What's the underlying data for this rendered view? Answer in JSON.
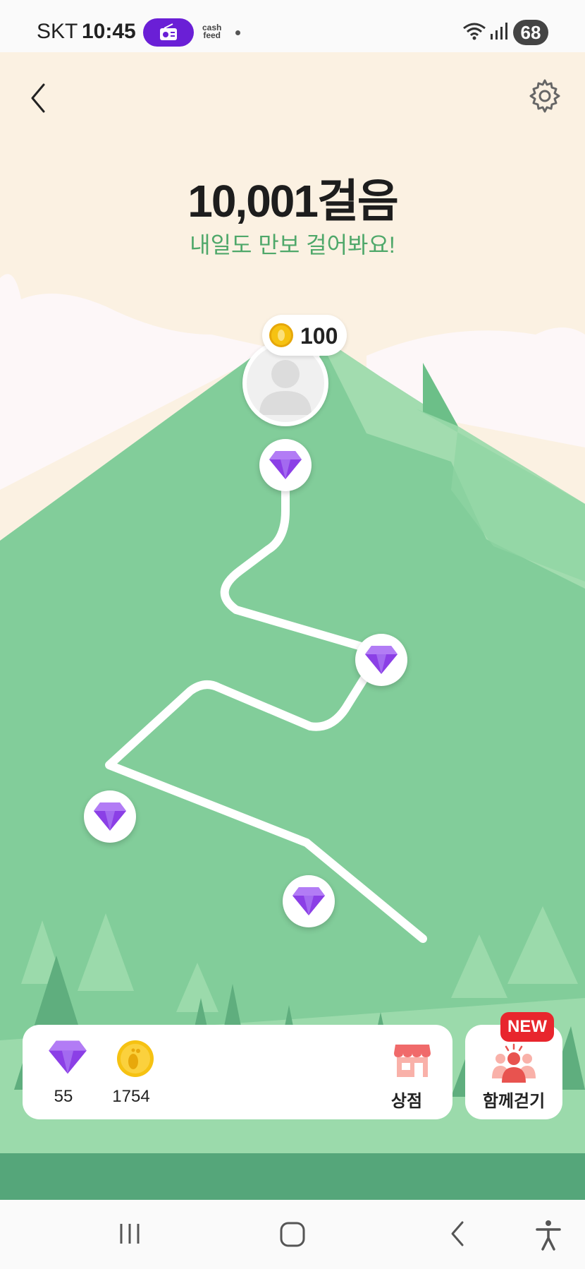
{
  "status_bar": {
    "carrier": "SKT",
    "time": "10:45",
    "notification_label": "cash feed",
    "battery": "68"
  },
  "header": {
    "back_icon": "chevron-left-icon",
    "settings_icon": "gear-icon"
  },
  "hero": {
    "steps": "10,001걸음",
    "subtitle": "내일도 만보 걸어봐요!"
  },
  "reward_bubble": {
    "amount": "100",
    "icon": "coin-icon"
  },
  "route": {
    "nodes": [
      "gem-icon",
      "gem-icon",
      "gem-icon",
      "gem-icon"
    ]
  },
  "bottom_bar": {
    "gems": "55",
    "coins": "1754",
    "shop_label": "상점",
    "walk_together_label": "함께걷기",
    "new_badge": "NEW"
  },
  "colors": {
    "sky": "#fbf1e2",
    "mountain": "#80cd9a",
    "accent_text": "#4fa86a",
    "gem": "#8b3fe6",
    "coin": "#f6c212",
    "badge": "#e8262d"
  },
  "nav_bar": {
    "recent_icon": "recent-apps-icon",
    "home_icon": "home-icon",
    "back_icon": "back-icon",
    "accessibility_icon": "accessibility-icon"
  }
}
